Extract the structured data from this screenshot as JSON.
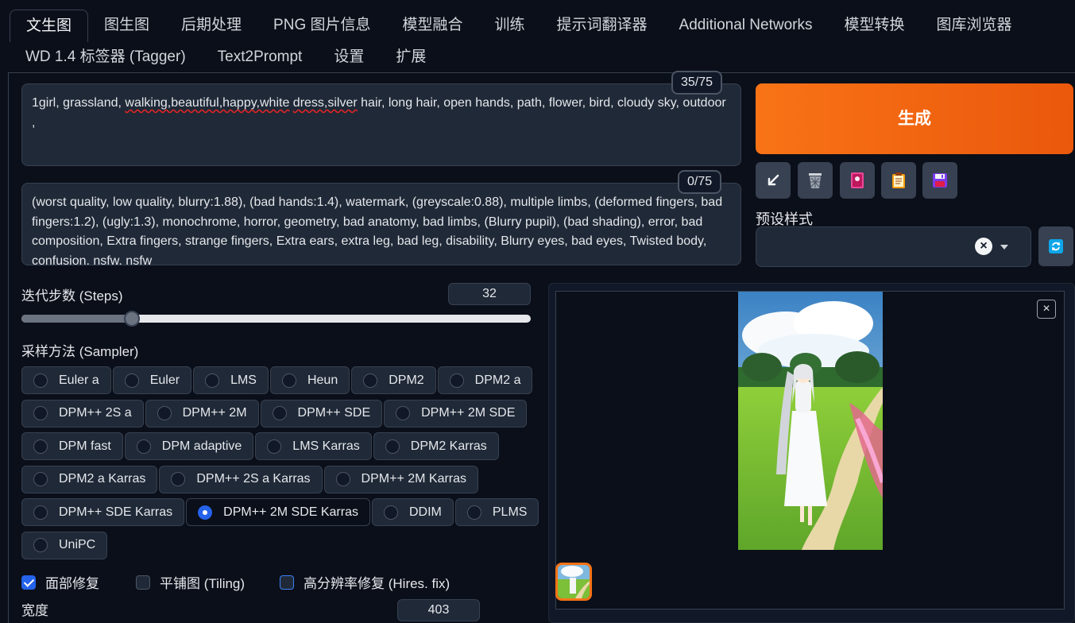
{
  "tabs": {
    "row1": [
      "文生图",
      "图生图",
      "后期处理",
      "PNG 图片信息",
      "模型融合",
      "训练",
      "提示词翻译器",
      "Additional Networks",
      "模型转换",
      "图库浏览器"
    ],
    "row2": [
      "WD 1.4 标签器 (Tagger)",
      "Text2Prompt",
      "设置",
      "扩展"
    ],
    "active": "文生图"
  },
  "prompt": {
    "positive": {
      "counter": "35/75",
      "text_before": "1girl, grassland, ",
      "text_squiggle1": "walking,beautiful,happy,white",
      "text_mid": " ",
      "text_squiggle2": "dress,silver",
      "text_after": " hair, long hair, open hands, path, flower, bird, cloudy sky, outdoor ,"
    },
    "negative": {
      "counter": "0/75",
      "text": "(worst quality, low quality, blurry:1.88), (bad hands:1.4), watermark, (greyscale:0.88), multiple limbs, (deformed fingers, bad fingers:1.2), (ugly:1.3), monochrome, horror, geometry, bad anatomy, bad limbs, (Blurry pupil), (bad shading), error, bad composition, Extra fingers, strange fingers, Extra ears, extra leg, bad leg, disability, Blurry eyes, bad eyes, Twisted body, confusion, nsfw, nsfw"
    }
  },
  "actions": {
    "generate_label": "生成",
    "tools": [
      "arrow-icon",
      "trash-icon",
      "extra-networks-icon",
      "clipboard-icon",
      "save-icon"
    ]
  },
  "styles": {
    "label": "预设样式",
    "clear": "×"
  },
  "steps": {
    "label": "迭代步数 (Steps)",
    "value": "32",
    "min": 1,
    "max": 150,
    "current": 32
  },
  "sampler": {
    "label": "采样方法 (Sampler)",
    "rows": [
      [
        "Euler a",
        "Euler",
        "LMS",
        "Heun",
        "DPM2",
        "DPM2 a"
      ],
      [
        "DPM++ 2S a",
        "DPM++ 2M",
        "DPM++ SDE",
        "DPM++ 2M SDE"
      ],
      [
        "DPM fast",
        "DPM adaptive",
        "LMS Karras",
        "DPM2 Karras"
      ],
      [
        "DPM2 a Karras",
        "DPM++ 2S a Karras",
        "DPM++ 2M Karras"
      ],
      [
        "DPM++ SDE Karras",
        "DPM++ 2M SDE Karras",
        "DDIM",
        "PLMS"
      ],
      [
        "UniPC"
      ]
    ],
    "selected": "DPM++ 2M SDE Karras"
  },
  "options": {
    "restore_faces": "面部修复",
    "tiling": "平铺图 (Tiling)",
    "hires_fix": "高分辨率修复 (Hires. fix)"
  },
  "width": {
    "label": "宽度",
    "value": "403"
  },
  "gallery": {
    "close": "×"
  },
  "colors": {
    "accent": "#f97316",
    "selected": "#2563eb",
    "background": "#0b0f19"
  }
}
